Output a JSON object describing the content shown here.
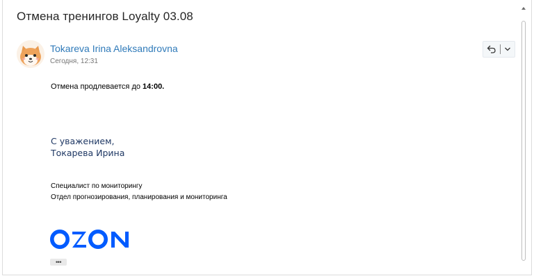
{
  "email": {
    "subject": "Отмена тренингов Loyalty 03.08",
    "sender_name": "Tokareva Irina Aleksandrovna",
    "sent_time": "Сегодня, 12:31",
    "body_prefix": "Отмена продлевается до ",
    "body_bold": "14:00.",
    "regards_line1": "С уважением,",
    "regards_line2": "Токарева Ирина",
    "position": "Специалист по мониторингу",
    "department": "Отдел прогнозирования, планирования и мониторинга",
    "logo_text": "OZON",
    "expand_label": "•••"
  },
  "colors": {
    "link": "#2f7ab9",
    "signature": "#1f3864",
    "ozon_blue": "#005bff"
  },
  "icons": {
    "reply": "reply-icon",
    "more": "chevron-down-icon",
    "avatar": "shiba-dog-avatar"
  }
}
